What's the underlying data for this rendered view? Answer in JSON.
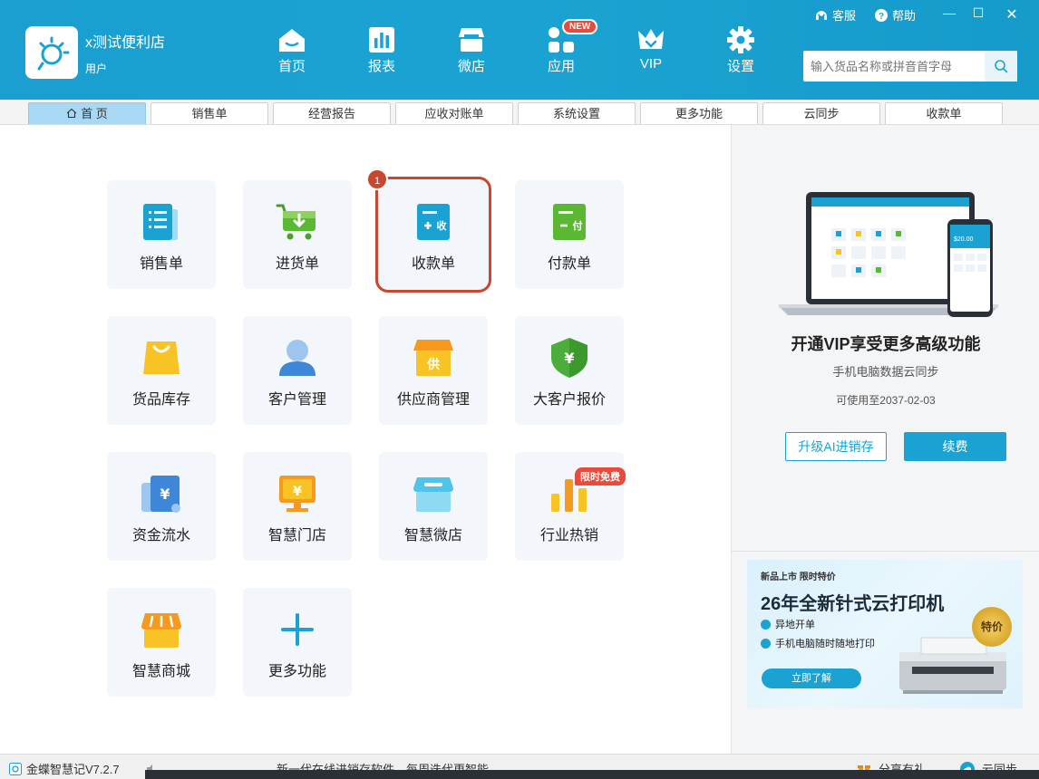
{
  "header": {
    "store_name": "x测试便利店",
    "store_role": "用户",
    "nav": [
      {
        "label": "首页",
        "icon": "home-icon"
      },
      {
        "label": "报表",
        "icon": "report-icon"
      },
      {
        "label": "微店",
        "icon": "shop-icon"
      },
      {
        "label": "应用",
        "icon": "apps-icon"
      },
      {
        "label": "VIP",
        "icon": "vip-icon"
      },
      {
        "label": "设置",
        "icon": "gear-icon"
      }
    ],
    "new_badge": "NEW",
    "service_label": "客服",
    "help_label": "帮助",
    "search_placeholder": "输入货品名称或拼音首字母"
  },
  "tabs": [
    {
      "label": "首 页",
      "active": true
    },
    {
      "label": "销售单"
    },
    {
      "label": "经营报告"
    },
    {
      "label": "应收对账单"
    },
    {
      "label": "系统设置"
    },
    {
      "label": "更多功能"
    },
    {
      "label": "云同步"
    },
    {
      "label": "收款单"
    }
  ],
  "cards": [
    {
      "label": "销售单",
      "icon": "sales-order-icon"
    },
    {
      "label": "进货单",
      "icon": "purchase-cart-icon"
    },
    {
      "label": "收款单",
      "icon": "receipt-icon",
      "badge": "1"
    },
    {
      "label": "付款单",
      "icon": "payment-icon"
    },
    {
      "label": "货品库存",
      "icon": "inventory-bag-icon"
    },
    {
      "label": "客户管理",
      "icon": "customer-icon"
    },
    {
      "label": "供应商管理",
      "icon": "supplier-store-icon"
    },
    {
      "label": "大客户报价",
      "icon": "vip-quote-shield-icon"
    },
    {
      "label": "资金流水",
      "icon": "cashflow-icon"
    },
    {
      "label": "智慧门店",
      "icon": "smart-store-monitor-icon"
    },
    {
      "label": "智慧微店",
      "icon": "smart-microshop-icon"
    },
    {
      "label": "行业热销",
      "icon": "hot-sales-chart-icon",
      "badge": "限时免费"
    },
    {
      "label": "智慧商城",
      "icon": "smart-mall-icon"
    },
    {
      "label": "更多功能",
      "icon": "plus-icon"
    }
  ],
  "right_panel": {
    "vip_title": "开通VIP享受更多高级功能",
    "vip_subtitle": "手机电脑数据云同步",
    "vip_expiry": "可使用至2037-02-03",
    "upgrade_button": "升级AI进销存",
    "renew_button": "续费",
    "device_amount": "$20.00",
    "ad": {
      "tag": "新品上市 限时特价",
      "title": "26年全新针式云打印机",
      "features": [
        "异地开单",
        "手机电脑随时随地打印"
      ],
      "button": "立即了解",
      "seal": "特价"
    }
  },
  "statusbar": {
    "version": "金蝶智慧记V7.2.7",
    "slogan": "新一代在线进销存软件，每周迭代更智能",
    "share": "分享有礼",
    "sync": "云同步"
  },
  "colors": {
    "brand": "#1aa3d2",
    "highlight": "#c9462f",
    "badge_red": "#e84b3c"
  }
}
